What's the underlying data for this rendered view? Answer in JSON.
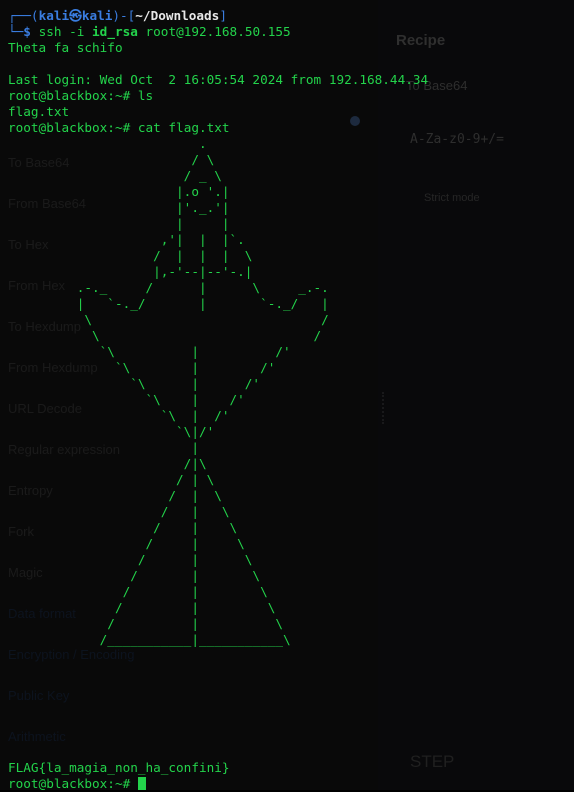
{
  "background_app": {
    "operations": [
      "To Base64",
      "From Base64",
      "To Hex",
      "From Hex",
      "To Hexdump",
      "From Hexdump",
      "URL Decode",
      "Regular expression",
      "Entropy",
      "Fork",
      "Magic",
      "Data format",
      "Encryption / Encoding",
      "Public Key",
      "Arithmetic"
    ],
    "recipe_title": "Recipe",
    "recipe_item": "To Base64",
    "alphabet": "A-Za-z0-9+/=",
    "remove_label": "Strict mode",
    "step_label": "STEP"
  },
  "terminal": {
    "prompt_open": "┌──(",
    "user": "kali",
    "at": "㉿",
    "host": "kali",
    "prompt_mid": ")-[",
    "cwd": "~/Downloads",
    "prompt_close": "]",
    "prompt_corner": "└─",
    "dollar": "$",
    "ssh_cmd": "ssh -i",
    "ssh_key": "id_rsa",
    "ssh_target": "root@192.168.50.155",
    "banner": "Theta fa schifo",
    "last_login": "Last login: Wed Oct  2 16:05:54 2024 from 192.168.44.34",
    "root_prompt": "root@blackbox:~#",
    "ls_cmd": "ls",
    "ls_output": "flag.txt",
    "cat_cmd": "cat flag.txt",
    "ascii_art": "                         .\n                        / \\\n                       / _ \\\n                      |.o '.|\n                      |'._.'|\n                      |     |\n                    ,'|  |  |`.\n                   /  |  |  |  \\\n                   |,-'--|--'-.|\n         .-._     /      |      \\     _.-.\n         |   `-._/       |       `-._/   |\n          \\                              /\n           \\                            /\n            `\\          |          /'\n              `\\        |        /'\n                `\\      |      /'\n                  `\\    |    /'\n                    `\\  |  /'\n                      `\\|/'\n                        |\n                       /|\\\n                      / | \\\n                     /  |  \\\n                    /   |   \\\n                   /    |    \\\n                  /     |     \\\n                 /      |      \\\n                /       |       \\\n               /        |        \\\n              /         |         \\\n             /          |          \\\n            /___________|___________\\",
    "flag": "FLAG{la_magia_non_ha_confini}",
    "final_prompt": "root@blackbox:~#"
  },
  "colors": {
    "terminal_green": "#23d34b",
    "prompt_blue": "#3a7de0",
    "background": "#000000"
  }
}
